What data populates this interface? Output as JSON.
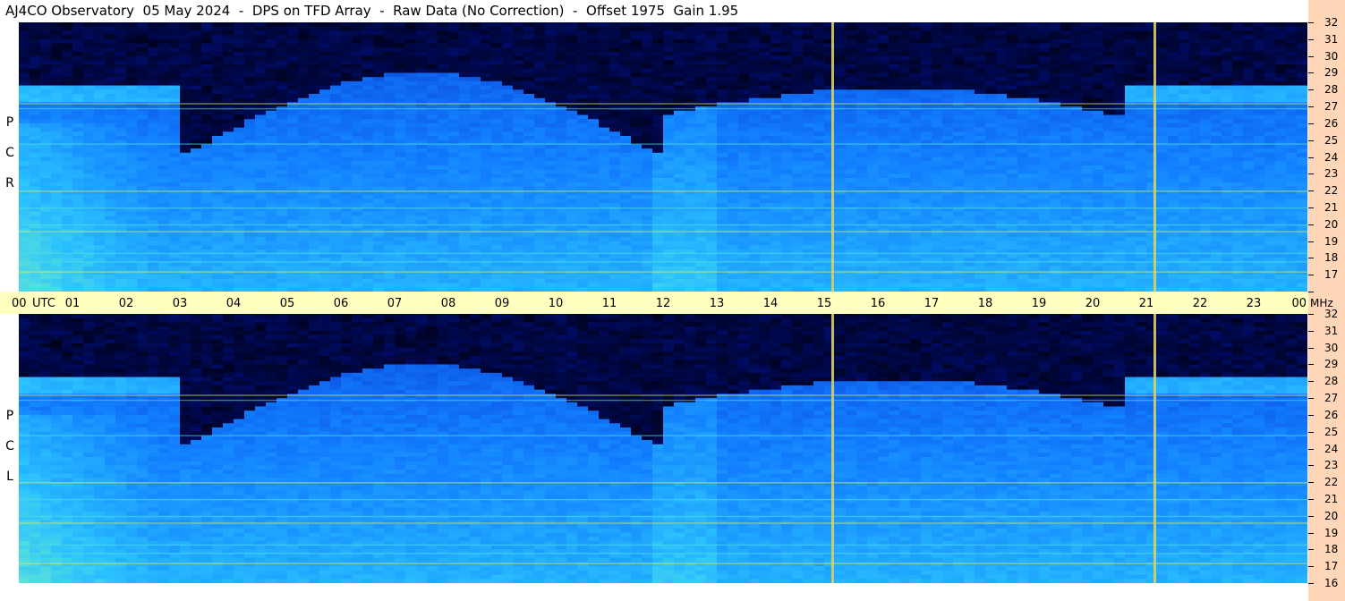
{
  "title": "AJ4CO Observatory  05 May 2024  -  DPS on TFD Array  -  Raw Data (No Correction)  -  Offset 1975  Gain 1.95",
  "chart_data": {
    "type": "heatmap",
    "title": "AJ4CO Observatory  05 May 2024  -  DPS on TFD Array  -  Raw Data (No Correction)  -  Offset 1975  Gain 1.95",
    "time_axis": {
      "ticks": [
        "00",
        "01",
        "02",
        "03",
        "04",
        "05",
        "06",
        "07",
        "08",
        "09",
        "10",
        "11",
        "12",
        "13",
        "14",
        "15",
        "16",
        "17",
        "18",
        "19",
        "20",
        "21",
        "22",
        "23",
        "00"
      ],
      "unit": "UTC",
      "range_hours": [
        0,
        24
      ]
    },
    "freq_axis": {
      "ticks": [
        32,
        31,
        30,
        29,
        28,
        27,
        26,
        25,
        24,
        23,
        22,
        21,
        20,
        19,
        18,
        17,
        16
      ],
      "unit": "MHz",
      "range": [
        16,
        32
      ]
    },
    "panels": [
      {
        "letters": [
          "R",
          "C",
          "P"
        ]
      },
      {
        "letters": [
          "L",
          "C",
          "P"
        ]
      }
    ],
    "vertical_markers_utc": [
      15.15,
      21.15
    ],
    "colormap": [
      "#000010",
      "#00107f",
      "#0a3fd8",
      "#1280ff",
      "#2ac0ff",
      "#6ef0c8",
      "#d6f060",
      "#ff7080"
    ]
  }
}
